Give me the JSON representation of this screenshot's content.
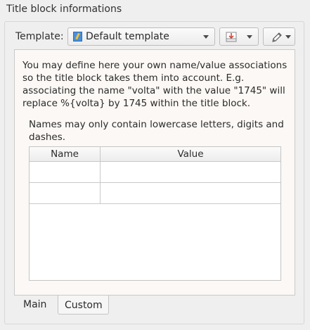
{
  "group": {
    "title": "Title block informations"
  },
  "template": {
    "label": "Template:",
    "selected": "Default template",
    "icon": "template-document-icon",
    "import_icon": "import-template-icon",
    "edit_icon": "pencil-edit-icon"
  },
  "info": {
    "paragraph": "You may define here your own name/value associations\nso the title block takes them into account. E.g.\nassociating the name \"volta\" with the value \"1745\" will\nreplace %{volta} by 1745 within the title block.",
    "names_hint": "Names may only contain lowercase letters, digits and\ndashes."
  },
  "table": {
    "columns": [
      "Name",
      "Value"
    ],
    "rows": [
      {
        "name": "",
        "value": ""
      },
      {
        "name": "",
        "value": ""
      }
    ]
  },
  "tabs": [
    {
      "label": "Main",
      "active": true
    },
    {
      "label": "Custom",
      "active": false
    }
  ]
}
